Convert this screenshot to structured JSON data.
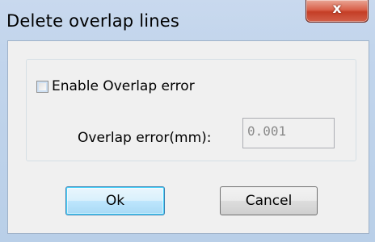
{
  "window": {
    "title": "Delete overlap lines",
    "close_glyph": "x"
  },
  "options": {
    "enable_overlap_label": "Enable Overlap error",
    "enable_overlap_checked": false,
    "overlap_error_label": "Overlap error(mm):",
    "overlap_error_value": "0.001"
  },
  "buttons": {
    "ok_label": "Ok",
    "cancel_label": "Cancel"
  },
  "colors": {
    "title_bar": "#c2d5ec",
    "client_bg": "#f0f0f0",
    "close_button": "#c43e26",
    "default_button_border": "#3c7fb1"
  }
}
